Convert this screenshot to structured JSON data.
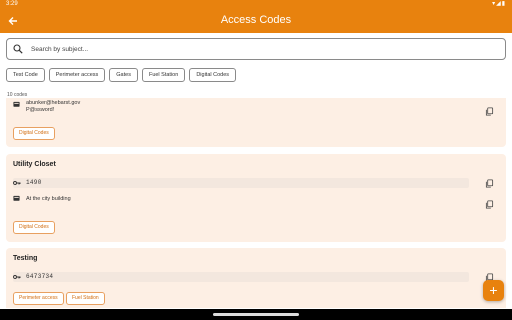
{
  "status_bar": {
    "time": "3:29",
    "icons": "▾◢▮"
  },
  "app_bar": {
    "title": "Access Codes",
    "back_icon": "arrow-back-icon"
  },
  "search": {
    "placeholder": "Search by subject..."
  },
  "filters": [
    "Test Code",
    "Perimeter access",
    "Gates",
    "Fuel Station",
    "Digital Codes"
  ],
  "count_label": "10 codes",
  "cards": [
    {
      "username": "abunker@hebarst.gov",
      "password": "P@ssword!",
      "tags": [
        "Digital Codes"
      ]
    },
    {
      "title": "Utility Closet",
      "code": "1490",
      "note": "At the city building",
      "tags": [
        "Digital Codes"
      ]
    },
    {
      "title": "Testing",
      "code": "6473734",
      "tags": [
        "Perimeter access",
        "Fuel Station"
      ]
    }
  ],
  "fab": {
    "label": "+"
  },
  "colors": {
    "accent": "#e8820e",
    "card_bg": "#fdefe4",
    "tag_text": "#d26d10"
  }
}
